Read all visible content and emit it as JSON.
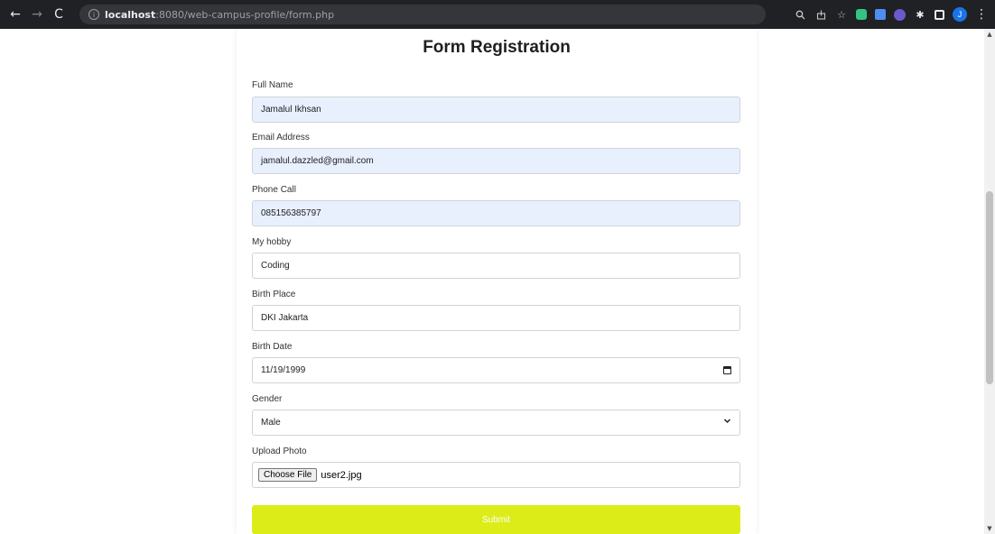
{
  "browser": {
    "url_host": "localhost",
    "url_rest": ":8080/web-campus-profile/form.php"
  },
  "form": {
    "title": "Form Registration",
    "fields": {
      "full_name": {
        "label": "Full Name",
        "value": "Jamalul Ikhsan"
      },
      "email": {
        "label": "Email Address",
        "value": "jamalul.dazzled@gmail.com"
      },
      "phone": {
        "label": "Phone Call",
        "value": "085156385797"
      },
      "hobby": {
        "label": "My hobby",
        "value": "Coding"
      },
      "birth_place": {
        "label": "Birth Place",
        "value": "DKI Jakarta"
      },
      "birth_date": {
        "label": "Birth Date",
        "value": "11/19/1999"
      },
      "gender": {
        "label": "Gender",
        "value": "Male"
      },
      "photo": {
        "label": "Upload Photo",
        "button": "Choose File",
        "file_name": "user2.jpg"
      }
    },
    "submit_label": "Submit"
  },
  "colors": {
    "autofill_bg": "#e8f0fe",
    "submit_bg": "#dcec18",
    "chrome_bg": "#202124"
  },
  "icons": [
    "back-arrow-icon",
    "forward-arrow-icon",
    "reload-icon",
    "info-icon",
    "zoom-icon",
    "share-icon",
    "star-icon",
    "extension-icon",
    "puzzle-icon",
    "side-panel-icon",
    "avatar",
    "kebab-menu-icon",
    "calendar-icon",
    "chevron-down-icon"
  ],
  "profile": {
    "initial": "J"
  }
}
